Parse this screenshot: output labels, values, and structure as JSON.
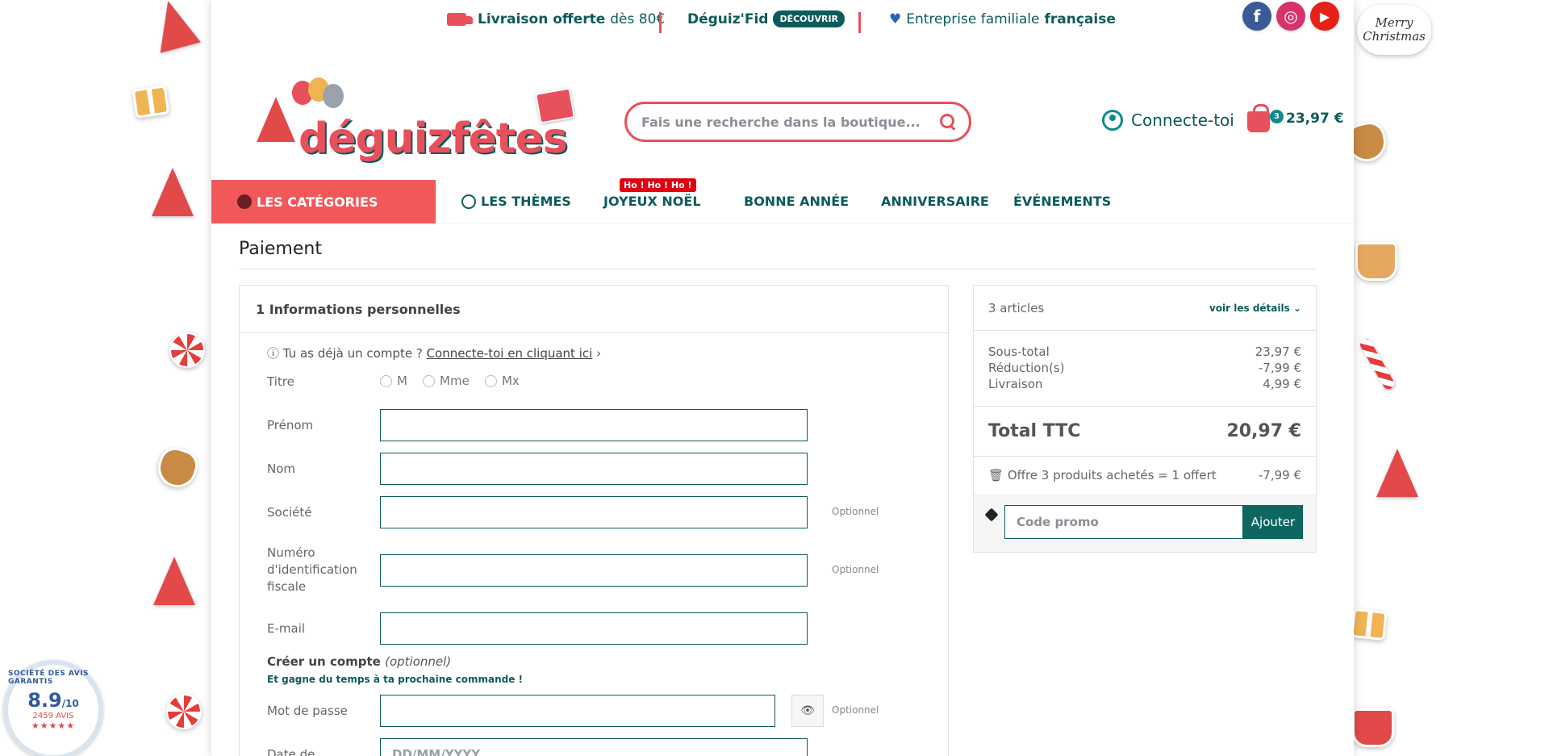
{
  "topbar": {
    "delivery_bold": "Livraison offerte",
    "delivery_rest": "dès 80€",
    "fid_label": "Déguiz'Fid",
    "fid_button": "DÉCOUVRIR",
    "family_text": "Entreprise familiale",
    "family_bold": "française",
    "social": [
      {
        "name": "facebook-icon",
        "glyph": "f",
        "color": "#3b5998"
      },
      {
        "name": "instagram-icon",
        "glyph": "◎",
        "color": "#d6336c"
      },
      {
        "name": "youtube-icon",
        "glyph": "▶",
        "color": "#e62117"
      }
    ]
  },
  "decorations": {
    "merry_christmas": "Merry Christmas"
  },
  "header": {
    "logo_text": "déguizfêtes",
    "search_placeholder": "Fais une recherche dans la boutique...",
    "account_label": "Connecte-toi",
    "cart_count": "3",
    "cart_total": "23,97 €"
  },
  "nav": {
    "categories": "LES CATÉGORIES",
    "items": [
      "LES THÈMES",
      "JOYEUX NOËL",
      "BONNE ANNÉE",
      "ANNIVERSAIRE",
      "ÉVÉNEMENTS"
    ],
    "ho_badge": "Ho ! Ho ! Ho !"
  },
  "page_title": "Paiement",
  "checkout": {
    "step_title": "1 Informations personnelles",
    "login_hint": "Tu as déjà un compte ?",
    "login_link": "Connecte-toi en cliquant ici",
    "titre_label": "Titre",
    "titles": [
      "M",
      "Mme",
      "Mx"
    ],
    "fields": {
      "prenom": "Prénom",
      "nom": "Nom",
      "societe": "Société",
      "tax_id": "Numéro d'identification fiscale",
      "email": "E-mail",
      "password": "Mot de passe",
      "birthdate": "Date de",
      "birthdate_placeholder": "DD/MM/YYYY"
    },
    "optional": "Optionnel",
    "create_account": "Créer un compte",
    "create_account_optional": "(optionnel)",
    "create_account_sub": "Et gagne du temps à ta prochaine commande !"
  },
  "summary": {
    "articles": "3 articles",
    "details_link": "voir les détails",
    "subtotal_label": "Sous-total",
    "subtotal_value": "23,97 €",
    "reduction_label": "Réduction(s)",
    "reduction_value": "-7,99 €",
    "shipping_label": "Livraison",
    "shipping_value": "4,99 €",
    "total_label": "Total TTC",
    "total_value": "20,97 €",
    "offer_label": "Offre 3 produits achetés = 1 offert",
    "offer_value": "-7,99 €",
    "promo_placeholder": "Code promo",
    "promo_button": "Ajouter"
  },
  "rating": {
    "label": "SOCIÉTÉ DES AVIS GARANTIS",
    "score": "8.9",
    "score_max": "/10",
    "count": "2459 AVIS"
  }
}
